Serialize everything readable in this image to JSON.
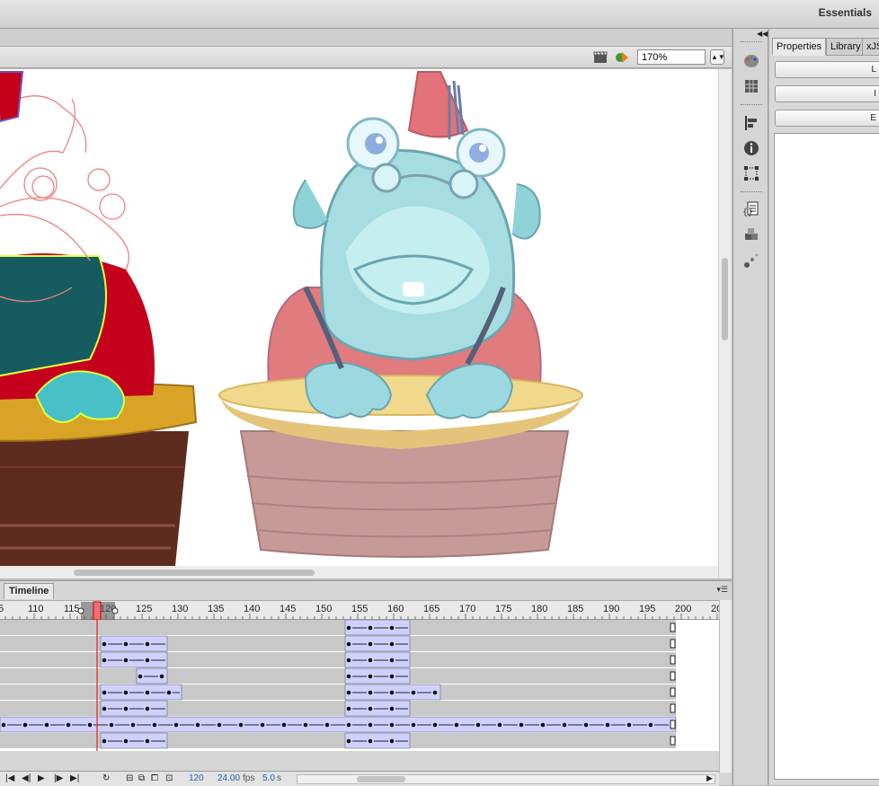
{
  "workspace": {
    "label": "Essentials"
  },
  "edit_bar": {
    "zoom_value": "170%"
  },
  "panel": {
    "tabs": [
      {
        "label": "Properties"
      },
      {
        "label": "Library"
      },
      {
        "label": "xJS"
      }
    ],
    "buttons": [
      {
        "label": "L"
      },
      {
        "label": "I"
      },
      {
        "label": "E"
      }
    ]
  },
  "timeline": {
    "tab_label": "Timeline",
    "ruler_labels": [
      "5",
      "110",
      "115",
      "120",
      "125",
      "130",
      "135",
      "140",
      "145",
      "150",
      "155",
      "160",
      "165",
      "170",
      "175",
      "180",
      "185",
      "190",
      "195",
      "200",
      "205"
    ],
    "current_frame": "120",
    "fps": "24.00",
    "fps_unit": "fps",
    "elapsed": "5.0",
    "elapsed_unit": "s"
  },
  "icons": {
    "tools": [
      "paint-palette-icon",
      "swatches-icon",
      "align-icon",
      "info-icon",
      "transform-icon",
      "code-snippets-icon",
      "components-icon",
      "motion-presets-icon"
    ]
  },
  "colors": {
    "playhead": "#e0302c",
    "tween": "#d0d0ff",
    "stage": "#ffffff"
  }
}
